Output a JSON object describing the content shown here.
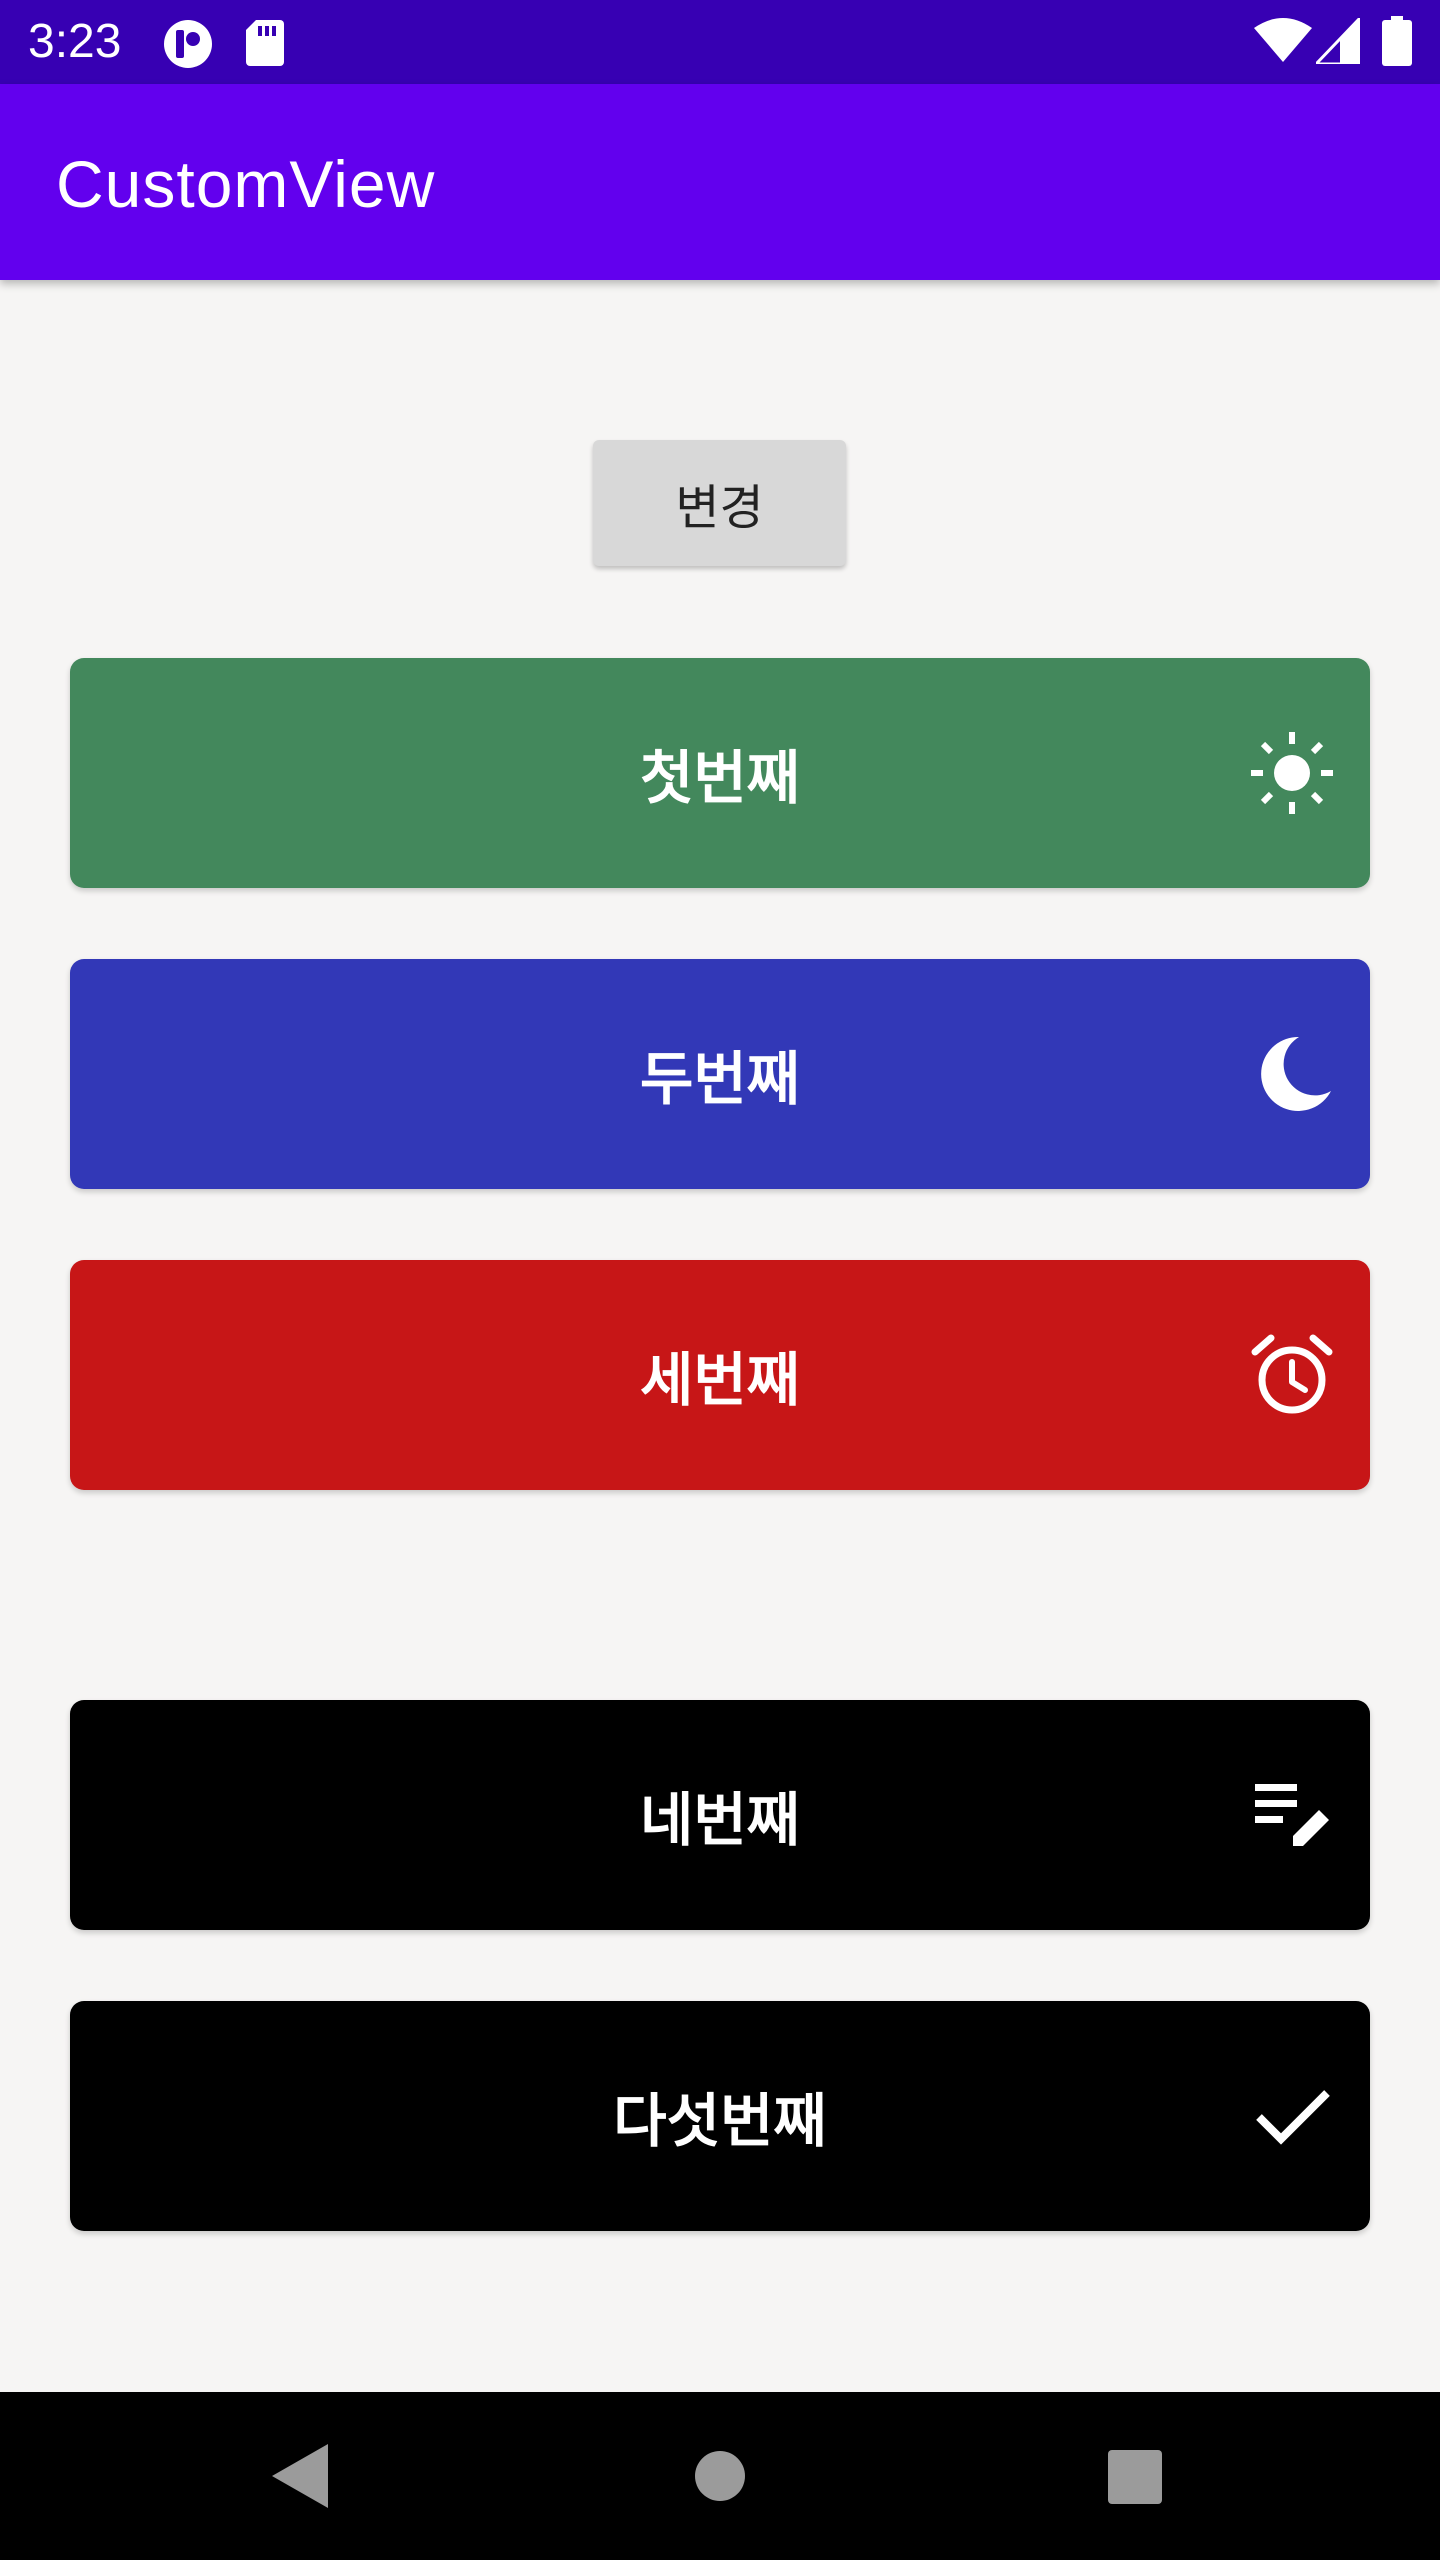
{
  "status_bar": {
    "time": "3:23",
    "icons": [
      "app-notification-icon",
      "sd-card-icon",
      "wifi-icon",
      "signal-icon",
      "battery-icon"
    ]
  },
  "app_bar": {
    "title": "CustomView"
  },
  "change_button": {
    "label": "변경"
  },
  "cards": [
    {
      "label": "첫번째",
      "color": "#43885c",
      "icon": "sun-icon"
    },
    {
      "label": "두번째",
      "color": "#3238b7",
      "icon": "moon-icon"
    },
    {
      "label": "세번째",
      "color": "#c71617",
      "icon": "alarm-clock-icon"
    },
    {
      "label": "네번째",
      "color": "#000000",
      "icon": "edit-note-icon"
    },
    {
      "label": "다섯번째",
      "color": "#000000",
      "icon": "check-icon"
    }
  ],
  "nav_bar": {
    "buttons": [
      "back-icon",
      "home-icon",
      "recents-icon"
    ]
  },
  "colors": {
    "status_bar": "#3700b3",
    "app_bar": "#6200ee",
    "background": "#f6f5f4"
  }
}
